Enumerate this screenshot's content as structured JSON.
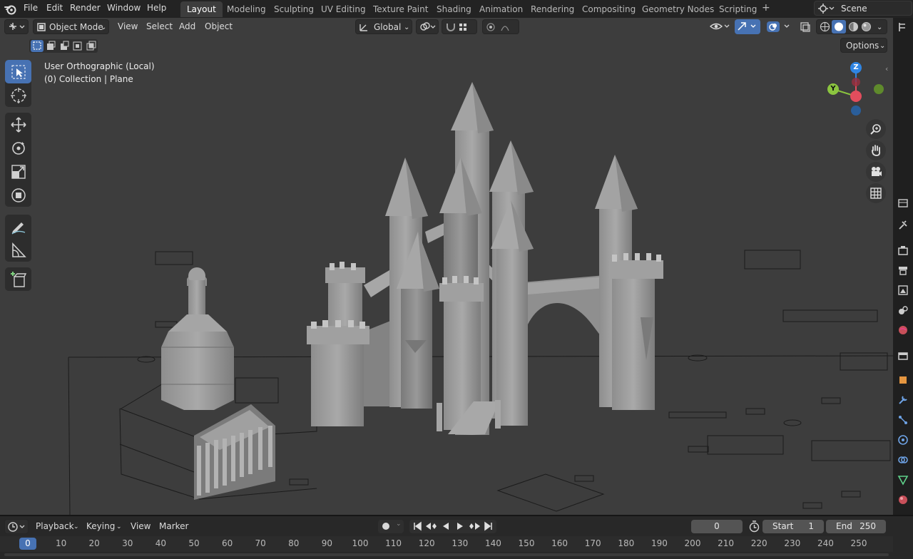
{
  "menu": [
    "File",
    "Edit",
    "Render",
    "Window",
    "Help"
  ],
  "workspaces": [
    {
      "label": "Layout",
      "active": true
    },
    {
      "label": "Modeling",
      "active": false
    },
    {
      "label": "Sculpting",
      "active": false
    },
    {
      "label": "UV Editing",
      "active": false
    },
    {
      "label": "Texture Paint",
      "active": false
    },
    {
      "label": "Shading",
      "active": false
    },
    {
      "label": "Animation",
      "active": false
    },
    {
      "label": "Rendering",
      "active": false
    },
    {
      "label": "Compositing",
      "active": false
    },
    {
      "label": "Geometry Nodes",
      "active": false
    },
    {
      "label": "Scripting",
      "active": false
    }
  ],
  "add_workspace": "+",
  "scene": "Scene",
  "viewport_header": {
    "mode": "Object Mode",
    "menus": [
      "View",
      "Select",
      "Add",
      "Object"
    ],
    "transform_orientation": "Global",
    "options": "Options"
  },
  "overlay": {
    "view_name": "User Orthographic (Local)",
    "collection": "(0) Collection | Plane"
  },
  "gizmo": {
    "z": "Z",
    "y": "Y",
    "x": "X"
  },
  "colors": {
    "accent": "#4772b3",
    "axis_x": "#e34d5d",
    "axis_y": "#8bc53f",
    "axis_z": "#2f85e3",
    "viewport_bg": "#3d3d3d"
  },
  "timeline": {
    "menus": [
      "Playback",
      "Keying",
      "View",
      "Marker"
    ],
    "current_frame": "0",
    "start_label": "Start",
    "start_value": "1",
    "end_label": "End",
    "end_value": "250",
    "ruler": [
      "0",
      "10",
      "20",
      "30",
      "40",
      "50",
      "60",
      "70",
      "80",
      "90",
      "100",
      "110",
      "120",
      "130",
      "140",
      "150",
      "160",
      "170",
      "180",
      "190",
      "200",
      "210",
      "220",
      "230",
      "240",
      "250"
    ]
  }
}
